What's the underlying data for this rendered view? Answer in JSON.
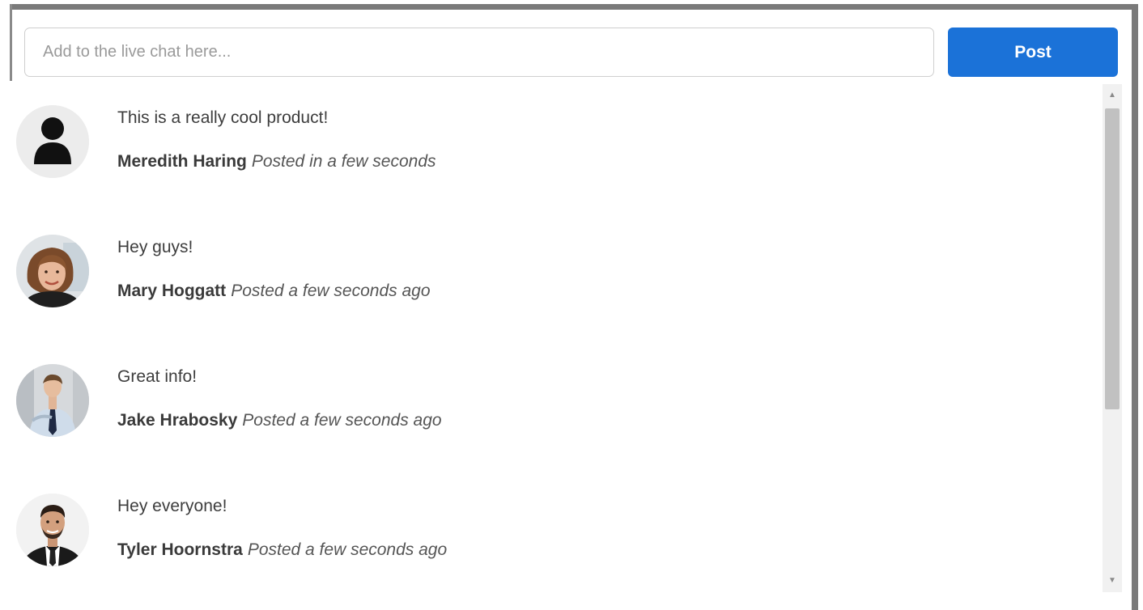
{
  "chat_input": {
    "placeholder": "Add to the live chat here...",
    "value": ""
  },
  "post_button": {
    "label": "Post"
  },
  "colors": {
    "accent": "#1b72d8",
    "text": "#3d3d3d"
  },
  "messages": [
    {
      "text": "This is a really cool product!",
      "author": "Meredith Haring",
      "time": "Posted in a few seconds",
      "avatar_icon": "default-user-icon"
    },
    {
      "text": "Hey guys!",
      "author": "Mary Hoggatt",
      "time": "Posted a few seconds ago",
      "avatar_icon": "woman-photo-avatar"
    },
    {
      "text": "Great info!",
      "author": "Jake Hrabosky",
      "time": "Posted a few seconds ago",
      "avatar_icon": "man-tie-photo-avatar"
    },
    {
      "text": "Hey everyone!",
      "author": "Tyler Hoornstra",
      "time": "Posted a few seconds ago",
      "avatar_icon": "man-suit-photo-avatar"
    }
  ]
}
